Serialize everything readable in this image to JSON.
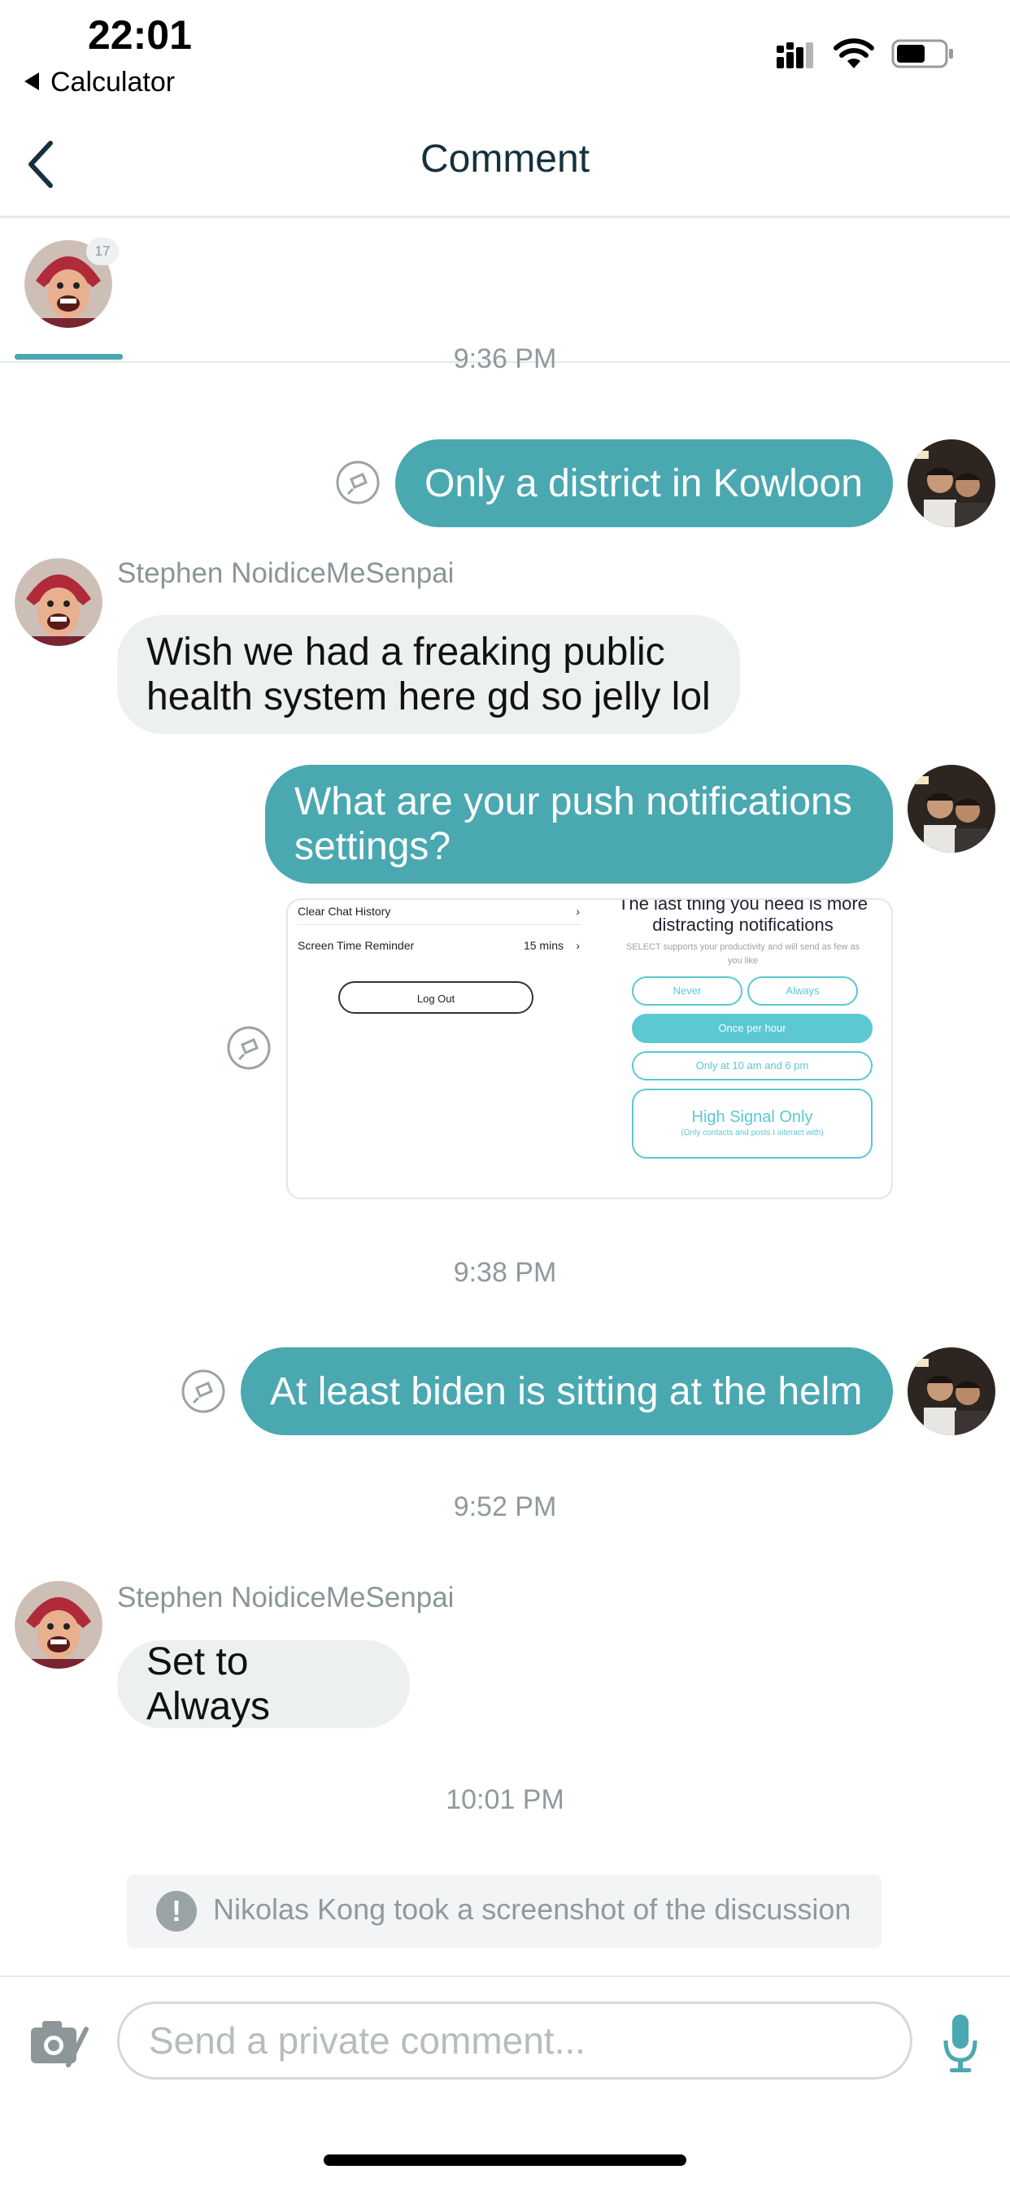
{
  "status_bar": {
    "time": "22:01",
    "back_app": "Calculator"
  },
  "nav": {
    "title": "Comment"
  },
  "participants": [
    {
      "badge": "17"
    }
  ],
  "messages": {
    "ts_partial": "9:36 PM",
    "m1": "Only a district in Kowloon",
    "m2_sender": "Stephen NoidiceMeSenpai",
    "m2": "Wish we had a freaking public health system here gd so jelly lol",
    "m3": "What are your push notifications settings?",
    "ts_938": "9:38 PM",
    "m4": "At least biden is sitting at the helm",
    "ts_952": "9:52 PM",
    "m5_sender": "Stephen NoidiceMeSenpai",
    "m5": "Set to Always",
    "ts_1001": "10:01 PM"
  },
  "shared_screenshot": {
    "clear_chat": "Clear Chat History",
    "screen_time": "Screen Time Reminder",
    "screen_time_value": "15 mins",
    "logout": "Log Out",
    "title": "The last thing you need is more distracting notifications",
    "subtitle": "SELECT supports your productivity and will send as few as you like",
    "never": "Never",
    "always": "Always",
    "once_per_hour": "Once per hour",
    "only_at": "Only at 10 am and 6 pm",
    "high_signal": "High Signal Only",
    "high_signal_sub": "(Only contacts and posts I interact with)"
  },
  "notice": {
    "text": "Nikolas Kong took a screenshot of the discussion"
  },
  "composer": {
    "placeholder": "Send a private comment..."
  },
  "colors": {
    "accent": "#4aa8b0",
    "incoming_bubble": "#edf0f0",
    "muted_text": "#8f9a9d"
  },
  "icons": [
    "back-chevron-icon",
    "camera-icon",
    "microphone-icon",
    "seen-icon",
    "wifi-icon",
    "battery-icon",
    "signal-icon",
    "alert-icon"
  ]
}
